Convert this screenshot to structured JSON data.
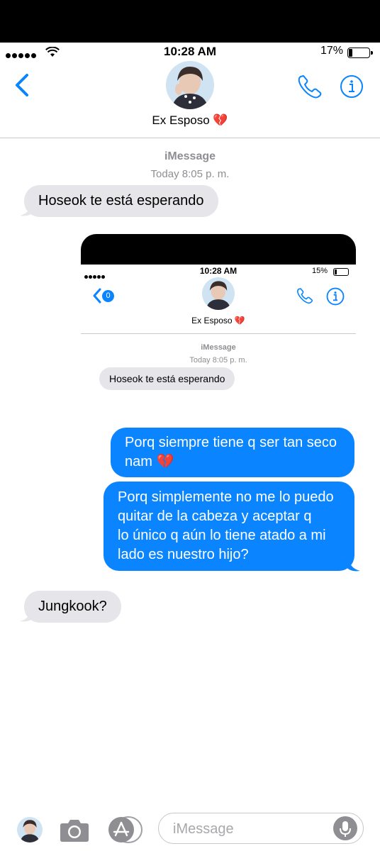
{
  "status": {
    "time": "10:28 AM",
    "battery": "17%"
  },
  "contact": {
    "name": "Ex Esposo 💔"
  },
  "thread": {
    "service": "iMessage",
    "timestamp": "Today 8:05 p. m."
  },
  "messages": [
    {
      "dir": "received",
      "text": "Hoseok te está esperando"
    },
    {
      "dir": "sent",
      "lines": [
        "Porq siempre tiene q ser tan seco",
        "nam 💔"
      ]
    },
    {
      "dir": "sent",
      "lines": [
        "Porq simplemente no me lo puedo",
        "quitar de la cabeza y aceptar q",
        "lo único q aún lo tiene atado a mi",
        "lado es nuestro hijo?"
      ]
    },
    {
      "dir": "received",
      "text": "Jungkook?"
    }
  ],
  "embedded_screenshot": {
    "time": "10:28 AM",
    "battery": "15%",
    "back_badge": "0",
    "contact_name": "Ex Esposo 💔",
    "service": "iMessage",
    "timestamp": "Today 8:05 p. m.",
    "message": "Hoseok te está esperando"
  },
  "composer": {
    "placeholder": "iMessage"
  },
  "colors": {
    "accent": "#0a84ff",
    "received_bubble": "#e5e5ea"
  },
  "icons": [
    "back-chevron-icon",
    "phone-icon",
    "info-icon",
    "camera-icon",
    "app-store-icon",
    "microphone-icon",
    "wifi-icon",
    "signal-dots-icon",
    "battery-icon"
  ]
}
